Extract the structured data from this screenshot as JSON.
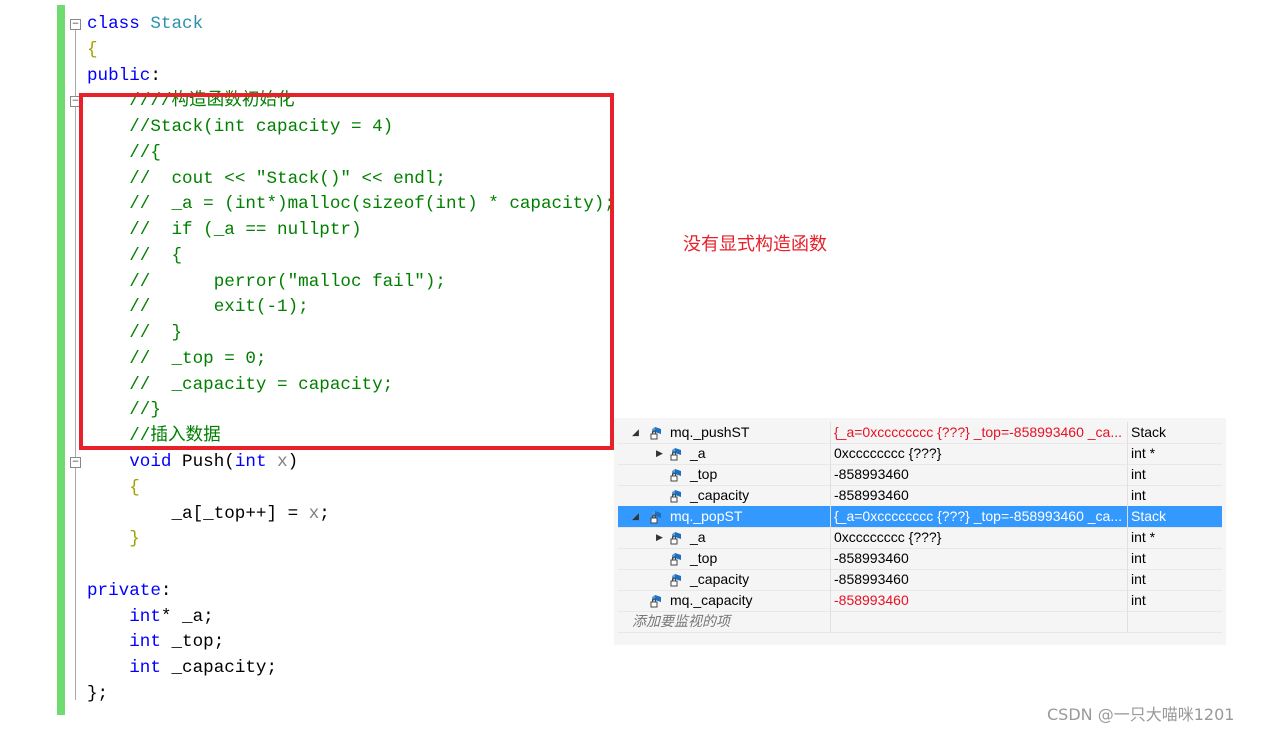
{
  "code": [
    [
      [
        "kw",
        "class "
      ],
      [
        "ty",
        "Stack"
      ]
    ],
    [
      [
        "br",
        "{"
      ]
    ],
    [
      [
        "kw",
        "public"
      ],
      [
        "tx",
        ":"
      ]
    ],
    [
      [
        "tx",
        "    "
      ],
      [
        "cm",
        "////构造函数初始化"
      ]
    ],
    [
      [
        "tx",
        "    "
      ],
      [
        "cm",
        "//Stack(int capacity = 4)"
      ]
    ],
    [
      [
        "tx",
        "    "
      ],
      [
        "cm",
        "//{"
      ]
    ],
    [
      [
        "tx",
        "    "
      ],
      [
        "cm",
        "//  cout << \"Stack()\" << endl;"
      ]
    ],
    [
      [
        "tx",
        "    "
      ],
      [
        "cm",
        "//  _a = (int*)malloc(sizeof(int) * capacity);"
      ]
    ],
    [
      [
        "tx",
        "    "
      ],
      [
        "cm",
        "//  if (_a == nullptr)"
      ]
    ],
    [
      [
        "tx",
        "    "
      ],
      [
        "cm",
        "//  {"
      ]
    ],
    [
      [
        "tx",
        "    "
      ],
      [
        "cm",
        "//      perror(\"malloc fail\");"
      ]
    ],
    [
      [
        "tx",
        "    "
      ],
      [
        "cm",
        "//      exit(-1);"
      ]
    ],
    [
      [
        "tx",
        "    "
      ],
      [
        "cm",
        "//  }"
      ]
    ],
    [
      [
        "tx",
        "    "
      ],
      [
        "cm",
        "//  _top = 0;"
      ]
    ],
    [
      [
        "tx",
        "    "
      ],
      [
        "cm",
        "//  _capacity = capacity;"
      ]
    ],
    [
      [
        "tx",
        "    "
      ],
      [
        "cm",
        "//}"
      ]
    ],
    [
      [
        "tx",
        "    "
      ],
      [
        "cm",
        "//插入数据"
      ]
    ],
    [
      [
        "tx",
        "    "
      ],
      [
        "kw",
        "void "
      ],
      [
        "tx",
        "Push("
      ],
      [
        "kw",
        "int "
      ],
      [
        "pm",
        "x"
      ],
      [
        "tx",
        ")"
      ]
    ],
    [
      [
        "tx",
        "    "
      ],
      [
        "br",
        "{"
      ]
    ],
    [
      [
        "tx",
        "        _a[_top++] = "
      ],
      [
        "pm",
        "x"
      ],
      [
        "tx",
        ";"
      ]
    ],
    [
      [
        "tx",
        "    "
      ],
      [
        "br",
        "}"
      ]
    ],
    [
      [
        "tx",
        ""
      ]
    ],
    [
      [
        "kw",
        "private"
      ],
      [
        "tx",
        ":"
      ]
    ],
    [
      [
        "tx",
        "    "
      ],
      [
        "kw",
        "int"
      ],
      [
        "tx",
        "* _a;"
      ]
    ],
    [
      [
        "tx",
        "    "
      ],
      [
        "kw",
        "int "
      ],
      [
        "tx",
        "_top;"
      ]
    ],
    [
      [
        "tx",
        "    "
      ],
      [
        "kw",
        "int "
      ],
      [
        "tx",
        "_capacity;"
      ]
    ],
    [
      [
        "tx",
        "};"
      ]
    ]
  ],
  "annotation": "没有显式构造函数",
  "watch": {
    "rows": [
      {
        "name": "mq._pushST",
        "value": "{_a=0xcccccccc {???} _top=-858993460 _ca...",
        "type": "Stack",
        "level": 0,
        "expand": "down",
        "red": true
      },
      {
        "name": "_a",
        "value": "0xcccccccc {???}",
        "type": "int *",
        "level": 1,
        "expand": "right",
        "red": false
      },
      {
        "name": "_top",
        "value": "-858993460",
        "type": "int",
        "level": 1,
        "expand": "",
        "red": false
      },
      {
        "name": "_capacity",
        "value": "-858993460",
        "type": "int",
        "level": 1,
        "expand": "",
        "red": false
      },
      {
        "name": "mq._popST",
        "value": "{_a=0xcccccccc {???} _top=-858993460 _ca...",
        "type": "Stack",
        "level": 0,
        "expand": "down",
        "red": true,
        "selected": true
      },
      {
        "name": "_a",
        "value": "0xcccccccc {???}",
        "type": "int *",
        "level": 1,
        "expand": "right",
        "red": false
      },
      {
        "name": "_top",
        "value": "-858993460",
        "type": "int",
        "level": 1,
        "expand": "",
        "red": false
      },
      {
        "name": "_capacity",
        "value": "-858993460",
        "type": "int",
        "level": 1,
        "expand": "",
        "red": false
      },
      {
        "name": "mq._capacity",
        "value": "-858993460",
        "type": "int",
        "level": 0,
        "expand": "",
        "red": true
      }
    ],
    "add_placeholder": "添加要监视的项"
  },
  "watermark": "CSDN @一只大喵咪1201",
  "colors": {
    "keyword": "#0000ff",
    "type": "#2b91af",
    "comment": "#008000",
    "highlight_box": "#e8202a",
    "selection": "#3399ff",
    "changed_value": "#e81123"
  }
}
